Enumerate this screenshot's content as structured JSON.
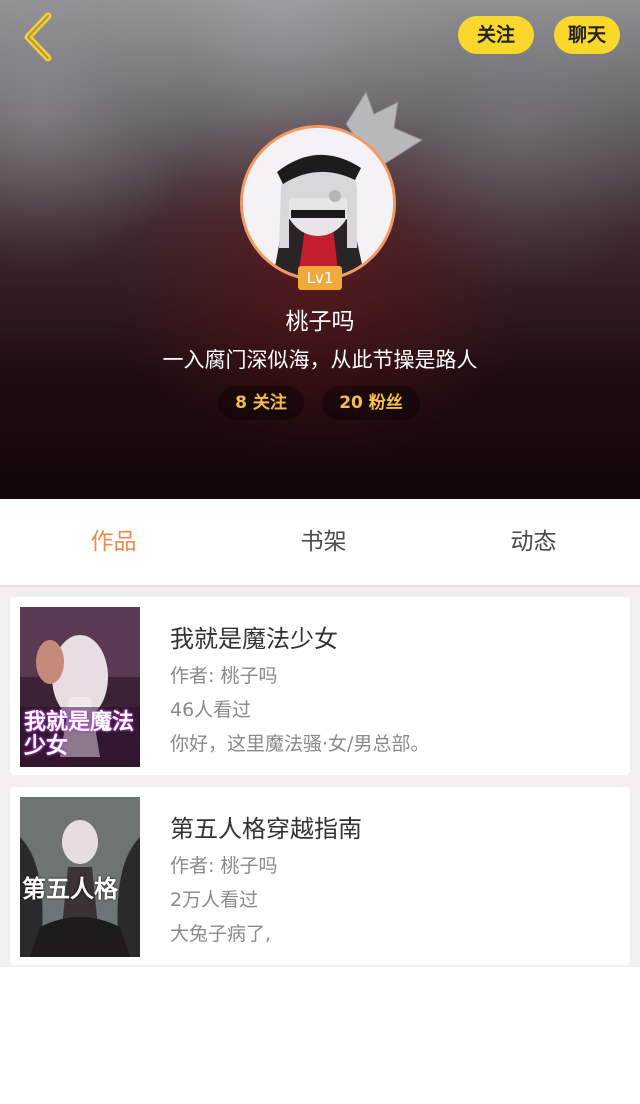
{
  "header": {
    "follow_label": "关注",
    "chat_label": "聊天",
    "accent_color": "#f8d92b"
  },
  "profile": {
    "level": "Lv1",
    "username": "桃子吗",
    "bio": "一入腐门深似海，从此节操是路人",
    "following": "8 关注",
    "fans": "20 粉丝"
  },
  "tabs": [
    {
      "label": "作品",
      "active": true
    },
    {
      "label": "书架",
      "active": false
    },
    {
      "label": "动态",
      "active": false
    }
  ],
  "works": [
    {
      "title": "我就是魔法少女",
      "author": "作者: 桃子吗",
      "views": "46人看过",
      "desc": "你好，这里魔法骚·女/男总部。",
      "cover_text": "我就是魔法少女"
    },
    {
      "title": "第五人格穿越指南",
      "author": "作者: 桃子吗",
      "views": "2万人看过",
      "desc": "大兔子病了,",
      "cover_text": "第五人格"
    }
  ]
}
